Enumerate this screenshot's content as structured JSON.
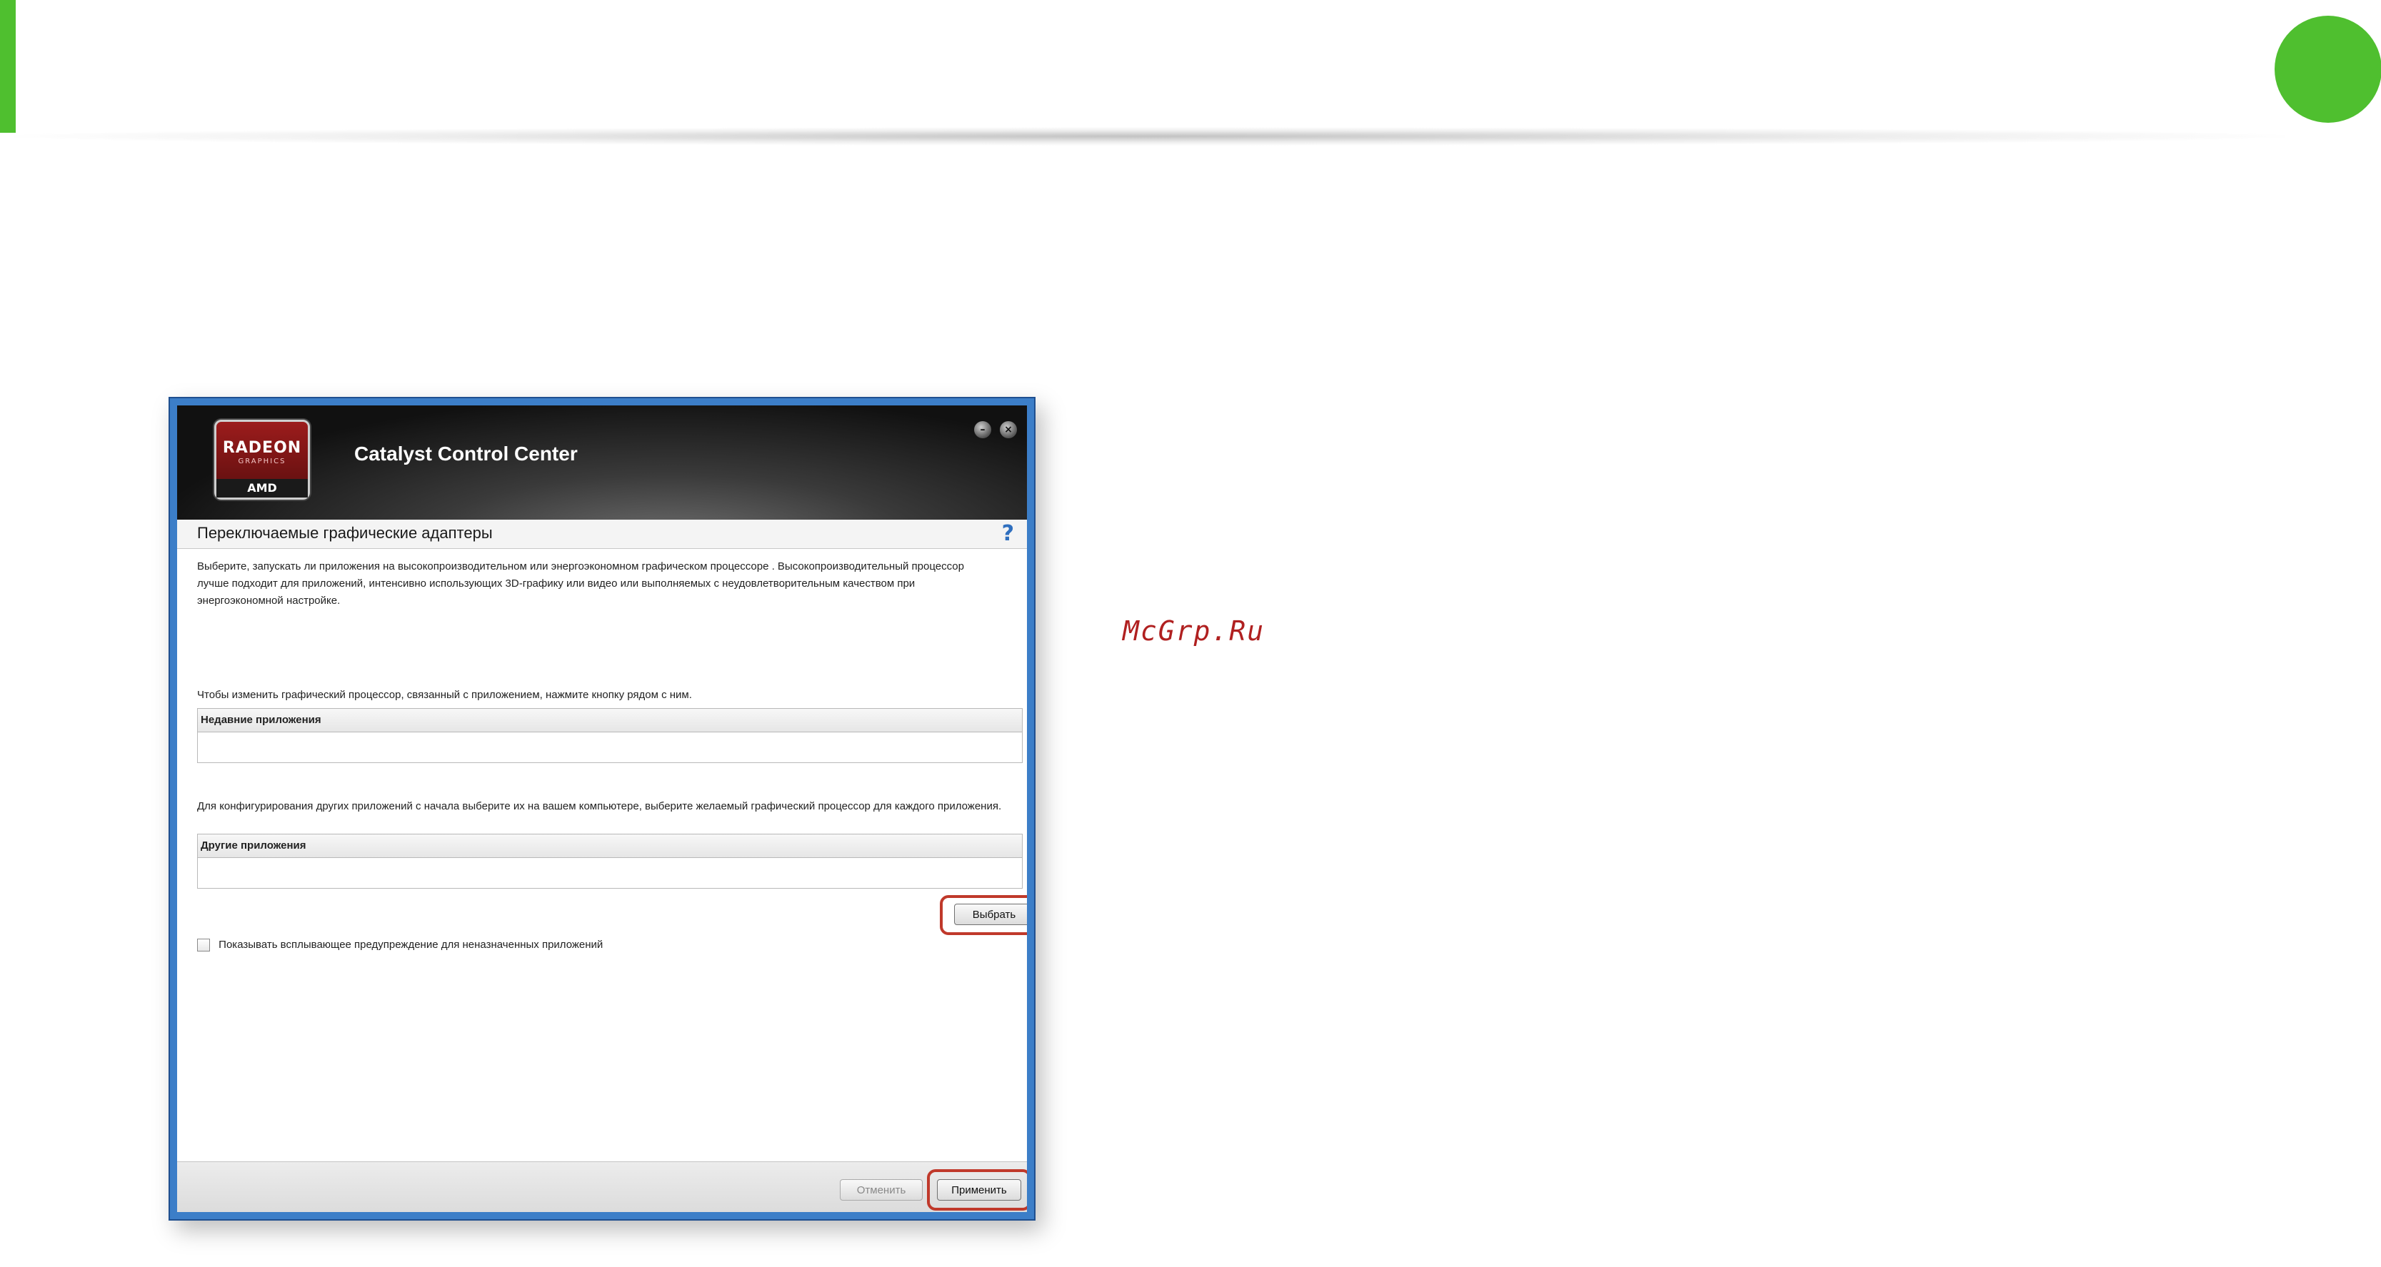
{
  "app": {
    "title": "Catalyst Control Center",
    "logo": {
      "radeon": "RADEON",
      "graphics": "GRAPHICS",
      "brand": "AMD"
    }
  },
  "page": {
    "title": "Переключаемые графические адаптеры",
    "help": "?"
  },
  "content": {
    "intro": "Выберите, запускать ли приложения на высокопроизводительном или энергоэкономном графическом процессоре . Высокопроизводительный процессор лучше подходит для приложений, интенсивно использующих 3D-графику или видео или выполняемых с неудовлетворительным качеством при энергоэкономной настройке.",
    "recent_hint": "Чтобы изменить графический процессор, связанный с приложением, нажмите кнопку рядом с ним.",
    "recent_header": "Недавние приложения",
    "other_hint": "Для конфигурирования других приложений с начала выберите их на вашем компьютере, выберите желаемый графический процессор для каждого приложения.",
    "other_header": "Другие приложения",
    "select_button": "Выбрать",
    "checkbox_label": "Показывать всплывающее предупреждение для неназначенных приложений"
  },
  "footer": {
    "cancel_button": "Отменить",
    "apply_button": "Применить"
  },
  "watermark": "McGrp.Ru",
  "colors": {
    "accent_green": "#4fbf2f",
    "highlight_red": "#c0392b",
    "window_blue": "#3c7ec8"
  }
}
